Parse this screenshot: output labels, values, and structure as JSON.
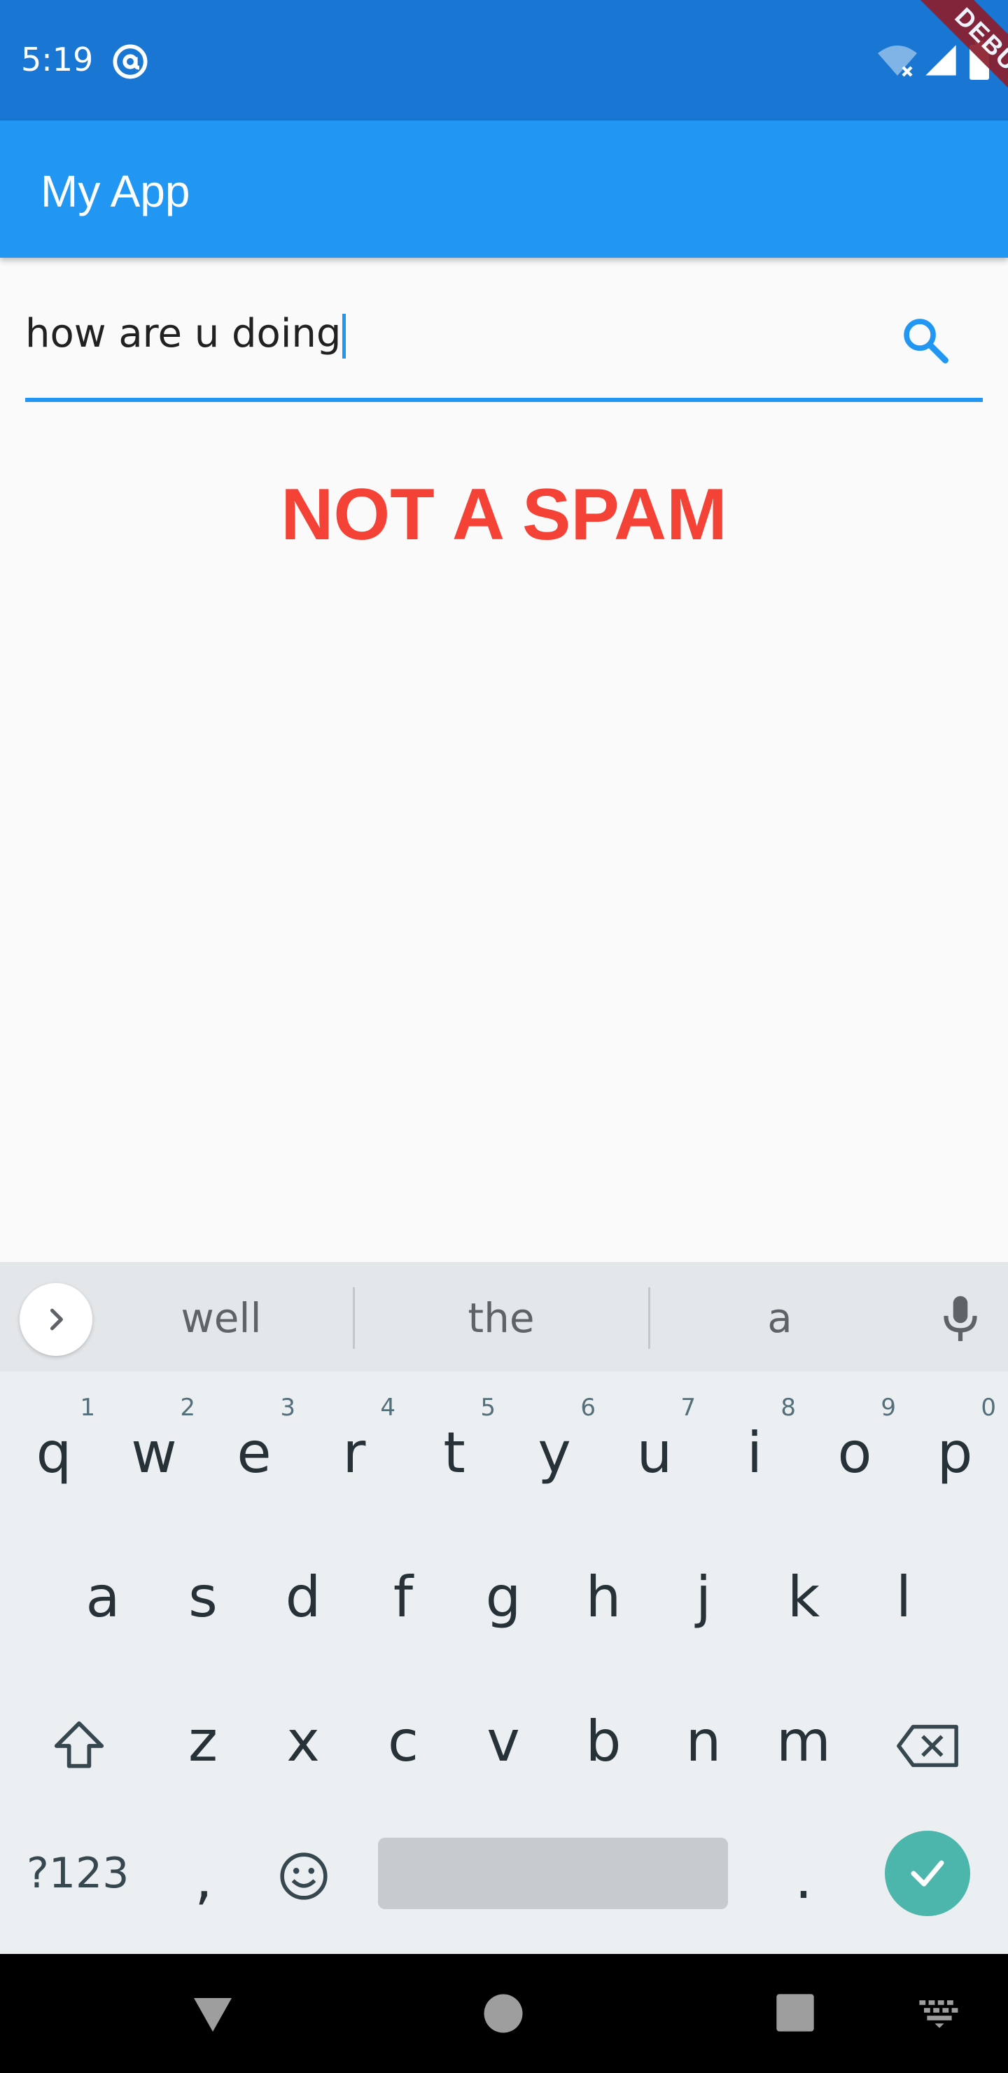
{
  "status_bar": {
    "time": "5:19",
    "debug_label": "DEBUG",
    "bg_color": "#1976d2"
  },
  "app_bar": {
    "title": "My App",
    "bg_color": "#2196f3"
  },
  "search": {
    "value": "how are u doing",
    "icon": "search-icon",
    "accent": "#2196f3"
  },
  "result": {
    "text": "NOT A SPAM",
    "color": "#f44336"
  },
  "keyboard": {
    "suggestions": [
      "well",
      "the",
      "a"
    ],
    "row1": [
      {
        "key": "q",
        "num": "1"
      },
      {
        "key": "w",
        "num": "2"
      },
      {
        "key": "e",
        "num": "3"
      },
      {
        "key": "r",
        "num": "4"
      },
      {
        "key": "t",
        "num": "5"
      },
      {
        "key": "y",
        "num": "6"
      },
      {
        "key": "u",
        "num": "7"
      },
      {
        "key": "i",
        "num": "8"
      },
      {
        "key": "o",
        "num": "9"
      },
      {
        "key": "p",
        "num": "0"
      }
    ],
    "row2": [
      "a",
      "s",
      "d",
      "f",
      "g",
      "h",
      "j",
      "k",
      "l"
    ],
    "row3": [
      "z",
      "x",
      "c",
      "v",
      "b",
      "n",
      "m"
    ],
    "symbols_label": "?123",
    "comma": ",",
    "period": ".",
    "enter_color": "#4db6ac"
  },
  "nav_bar": {
    "icons": [
      "back-icon",
      "home-icon",
      "recents-icon",
      "keyboard-switch-icon"
    ]
  }
}
